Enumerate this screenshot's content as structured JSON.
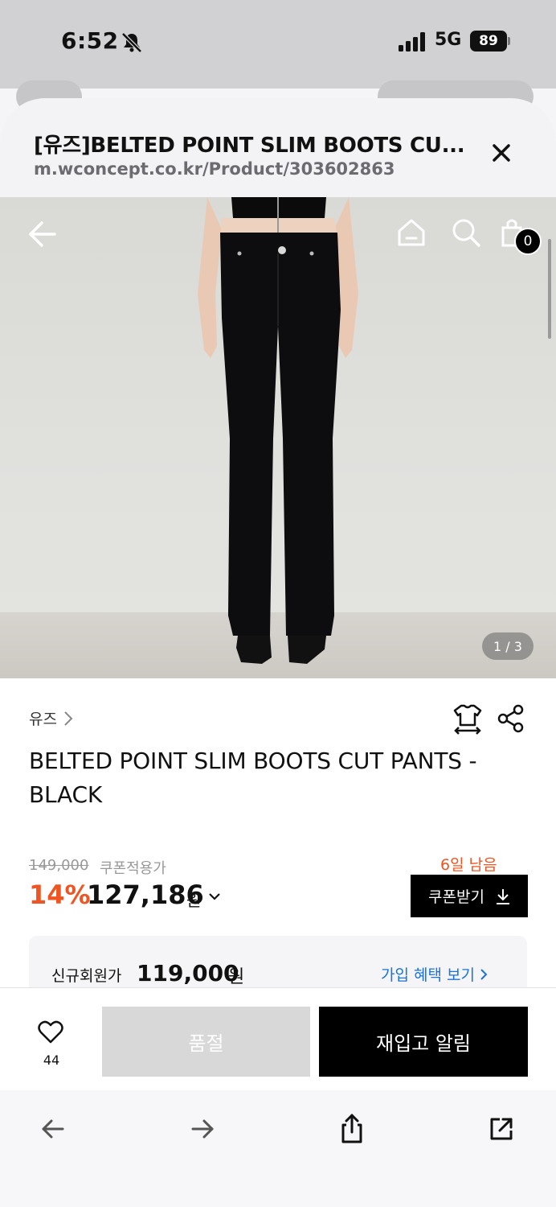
{
  "status_bar": {
    "time": "6:52",
    "network": "5G",
    "battery": "89"
  },
  "browser": {
    "page_title": "[유즈]BELTED POINT SLIM BOOTS CU...",
    "url": "m.wconcept.co.kr/Product/303602863"
  },
  "gallery": {
    "cart_count": "0",
    "page_indicator": "1 / 3"
  },
  "product": {
    "brand": "유즈",
    "title": "BELTED POINT SLIM BOOTS CUT PANTS - BLACK",
    "original_price": "149,000",
    "coupon_price_label": "쿠폰적용가",
    "days_left": "6일 남음",
    "discount": "14%",
    "sale_price": "127,186",
    "currency": "원",
    "coupon_button": "쿠폰받기",
    "member_label": "신규회원가",
    "member_price": "119,000",
    "member_currency": "원",
    "benefit_link": "가입 혜택 보기"
  },
  "action_bar": {
    "like_count": "44",
    "soldout_label": "품절",
    "restock_label": "재입고 알림"
  },
  "colors": {
    "accent": "#ee5522",
    "link": "#1a73d9",
    "primary_button": "#000000"
  }
}
